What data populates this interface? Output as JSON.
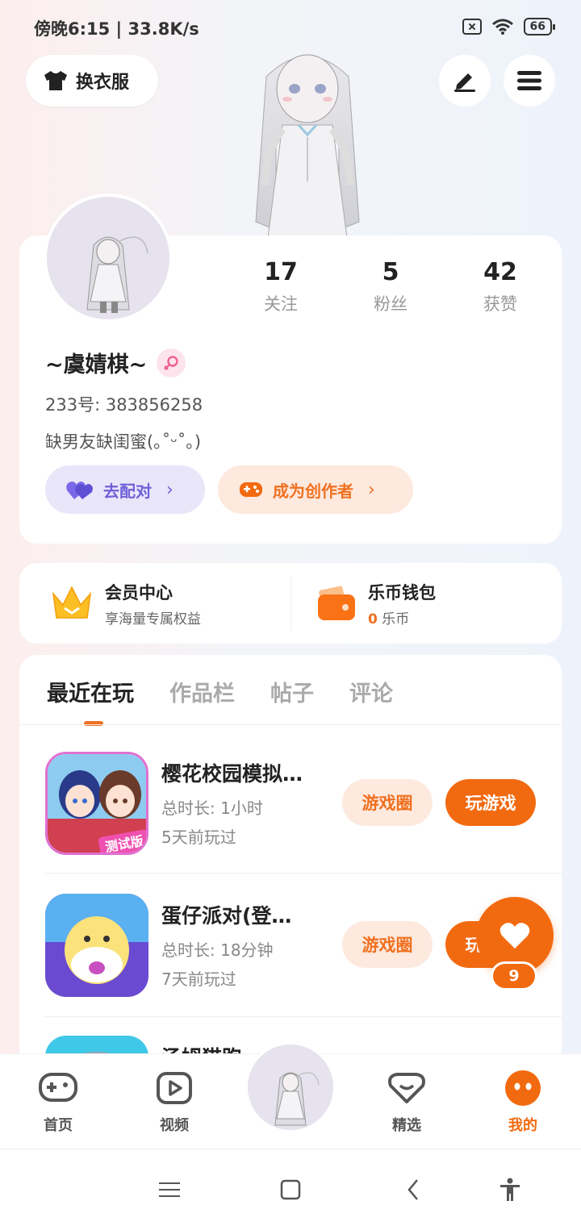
{
  "status_bar": {
    "left_text": "傍晚6:15 | 33.8K/s",
    "battery": "66"
  },
  "header": {
    "outfit_label": "换衣服"
  },
  "profile": {
    "stats": [
      {
        "num": "17",
        "label": "关注"
      },
      {
        "num": "5",
        "label": "粉丝"
      },
      {
        "num": "42",
        "label": "获赞"
      }
    ],
    "name": "~虞婧棋~",
    "uid": "233号: 383856258",
    "bio": "缺男友缺闺蜜(｡˚ᵕ˚｡)",
    "match_label": "去配对",
    "creator_label": "成为创作者"
  },
  "member": {
    "vip_title": "会员中心",
    "vip_sub": "享海量专属权益",
    "wallet_title": "乐币钱包",
    "wallet_amount": "0",
    "wallet_unit": "乐币"
  },
  "tabs": [
    "最近在玩",
    "作品栏",
    "帖子",
    "评论"
  ],
  "games": [
    {
      "title": "樱花校园模拟…",
      "duration": "总时长: 1小时",
      "last_played": "5天前玩过",
      "circle_label": "游戏圈",
      "play_label": "玩游戏",
      "badge": "测试版"
    },
    {
      "title": "蛋仔派对(登…",
      "duration": "总时长: 18分钟",
      "last_played": "7天前玩过",
      "circle_label": "游戏圈",
      "play_label": "玩游戏"
    },
    {
      "title": "汤姆猫跑…"
    }
  ],
  "fab": {
    "count": "9"
  },
  "nav": [
    "首页",
    "视频",
    "精选",
    "我的"
  ],
  "colors": {
    "accent": "#f26a10",
    "purple": "#7060d8"
  }
}
